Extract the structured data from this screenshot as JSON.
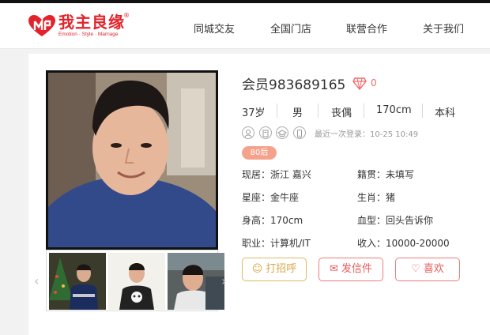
{
  "header": {
    "logo_text": "我主良缘",
    "logo_reg": "®",
    "logo_subtitle": "Emotion · Style · Marriage",
    "nav": [
      "同城交友",
      "全国门店",
      "联营合作",
      "关于我们"
    ]
  },
  "profile": {
    "title": "会员983689165",
    "gift_count": "0",
    "stats": [
      "37岁",
      "男",
      "丧偶",
      "170cm",
      "本科"
    ],
    "last_login": "最近一次登录：10-25 10:49",
    "tag": "80后",
    "details": {
      "residence": "现居：浙江 嘉兴",
      "hometown": "籍贯：未填写",
      "constellation": "星座：金牛座",
      "zodiac": "生肖：猪",
      "height": "身高：170cm",
      "blood": "血型：回头告诉你",
      "job": "职业：计算机/IT",
      "income": "收入：10000-20000"
    },
    "actions": {
      "greet": "打招呼",
      "mail": "发信件",
      "like": "喜欢"
    }
  },
  "gallery": {
    "prev_arrow": "‹",
    "next_arrow": "›"
  },
  "colors": {
    "brand": "#e3232b",
    "accent_pink": "#f06a6a",
    "greet_gold": "#d6a849",
    "tag_bg": "#f4a28c"
  }
}
